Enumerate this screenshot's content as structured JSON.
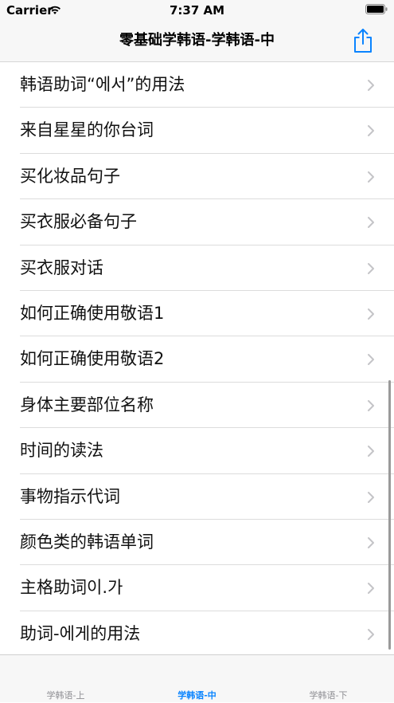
{
  "status_bar": {
    "carrier": "Carrier",
    "time": "7:37 AM"
  },
  "nav": {
    "title": "零基础学韩语-学韩语-中",
    "share_icon": "share-icon",
    "accent_color": "#0a84ff"
  },
  "list": {
    "items": [
      {
        "label": "韩语助词“에서”的用法"
      },
      {
        "label": "来自星星的你台词"
      },
      {
        "label": "买化妆品句子"
      },
      {
        "label": "买衣服必备句子"
      },
      {
        "label": "买衣服对话"
      },
      {
        "label": "如何正确使用敬语1"
      },
      {
        "label": "如何正确使用敬语2"
      },
      {
        "label": "身体主要部位名称"
      },
      {
        "label": "时间的读法"
      },
      {
        "label": "事物指示代词"
      },
      {
        "label": "颜色类的韩语单词"
      },
      {
        "label": "主格助词이.가"
      },
      {
        "label": "助词-에게的用法"
      }
    ]
  },
  "tabs": [
    {
      "label": "学韩语-上",
      "active": false
    },
    {
      "label": "学韩语-中",
      "active": true
    },
    {
      "label": "学韩语-下",
      "active": false
    }
  ]
}
